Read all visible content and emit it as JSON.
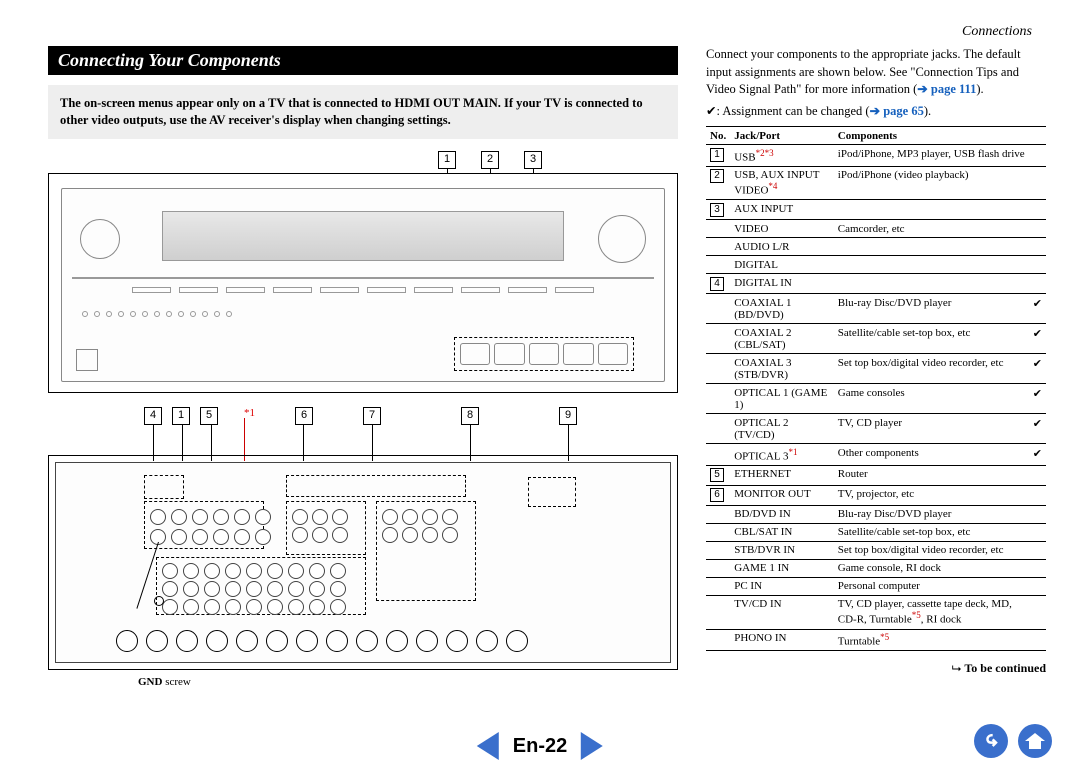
{
  "header": {
    "breadcrumb": "Connections"
  },
  "section_title": "Connecting Your Components",
  "note_box_parts": {
    "pre": "The on-screen menus appear only on a TV that is connected to ",
    "bold1": "HDMI OUT MAIN.",
    "mid": " If your TV is connected to other video outputs, use the AV receiver's display when changing settings."
  },
  "callouts_top": [
    "1",
    "2",
    "3"
  ],
  "callouts_bottom_row": [
    "4",
    "1",
    "5",
    "6",
    "7",
    "8",
    "9"
  ],
  "star_ref": "*1",
  "gnd_label_bold": "GND",
  "gnd_label_rest": " screw",
  "intro_para_parts": {
    "p1a": "Connect your components to the appropriate jacks. The default input assignments are shown below. See \"Connection Tips and Video Signal Path\" for more information (",
    "p1_arrow": "➔",
    "p1_link": " page 111",
    "p1b": ")."
  },
  "legend_parts": {
    "tick": "✔",
    "text": ": Assignment can be changed (",
    "arrow": "➔",
    "link": " page 65",
    "close": ")."
  },
  "table": {
    "headers": [
      "No.",
      "Jack/Port",
      "Components",
      ""
    ],
    "rows": [
      {
        "no": "1",
        "jack": [
          "USB",
          {
            "sup": "*2*3"
          }
        ],
        "comp": "iPod/iPhone, MP3 player, USB flash drive",
        "tick": ""
      },
      {
        "no": "2",
        "jack": [
          "USB, AUX INPUT VIDEO",
          {
            "sup": "*4"
          }
        ],
        "comp": "iPod/iPhone (video playback)",
        "tick": ""
      },
      {
        "no": "3",
        "jack": [
          "AUX INPUT"
        ],
        "comp": "",
        "tick": ""
      },
      {
        "no": "",
        "jack": [
          "VIDEO"
        ],
        "comp": "Camcorder, etc",
        "tick": ""
      },
      {
        "no": "",
        "jack": [
          "AUDIO L/R"
        ],
        "comp": "",
        "tick": ""
      },
      {
        "no": "",
        "jack": [
          "DIGITAL"
        ],
        "comp": "",
        "tick": ""
      },
      {
        "no": "4",
        "jack": [
          "DIGITAL IN"
        ],
        "comp": "",
        "tick": ""
      },
      {
        "no": "",
        "jack": [
          "COAXIAL 1 (BD/DVD)"
        ],
        "comp": "Blu-ray Disc/DVD player",
        "tick": "✔"
      },
      {
        "no": "",
        "jack": [
          "COAXIAL 2 (CBL/SAT)"
        ],
        "comp": "Satellite/cable set-top box, etc",
        "tick": "✔"
      },
      {
        "no": "",
        "jack": [
          "COAXIAL 3 (STB/DVR)"
        ],
        "comp": "Set top box/digital video recorder, etc",
        "tick": "✔"
      },
      {
        "no": "",
        "jack": [
          "OPTICAL 1 (GAME 1)"
        ],
        "comp": "Game consoles",
        "tick": "✔"
      },
      {
        "no": "",
        "jack": [
          "OPTICAL 2 (TV/CD)"
        ],
        "comp": "TV, CD player",
        "tick": "✔"
      },
      {
        "no": "",
        "jack": [
          "OPTICAL 3",
          {
            "sup": "*1"
          }
        ],
        "comp": "Other components",
        "tick": "✔"
      },
      {
        "no": "5",
        "jack": [
          "ETHERNET"
        ],
        "comp": "Router",
        "tick": ""
      },
      {
        "no": "6",
        "jack": [
          "MONITOR OUT"
        ],
        "comp": "TV, projector, etc",
        "tick": ""
      },
      {
        "no": "",
        "jack": [
          "BD/DVD IN"
        ],
        "comp": "Blu-ray Disc/DVD player",
        "tick": ""
      },
      {
        "no": "",
        "jack": [
          "CBL/SAT IN"
        ],
        "comp": "Satellite/cable set-top box, etc",
        "tick": ""
      },
      {
        "no": "",
        "jack": [
          "STB/DVR IN"
        ],
        "comp": "Set top box/digital video recorder, etc",
        "tick": ""
      },
      {
        "no": "",
        "jack": [
          "GAME 1 IN"
        ],
        "comp": "Game console, RI dock",
        "tick": ""
      },
      {
        "no": "",
        "jack": [
          "PC IN"
        ],
        "comp": "Personal computer",
        "tick": ""
      },
      {
        "no": "",
        "jack": [
          "TV/CD IN"
        ],
        "comp": [
          "TV, CD player, cassette tape deck, MD, CD-R, Turntable",
          {
            "sup": "*5"
          },
          ", RI dock"
        ],
        "tick": ""
      },
      {
        "no": "",
        "jack": [
          "PHONO IN"
        ],
        "comp": [
          "Turntable",
          {
            "sup": "*5"
          }
        ],
        "tick": ""
      }
    ]
  },
  "to_be_continued": "To be continued",
  "page_number": "En-22"
}
